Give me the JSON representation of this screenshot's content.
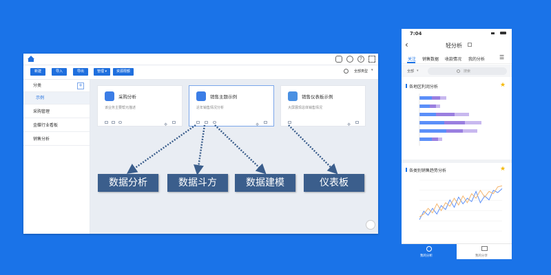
{
  "desktop": {
    "toolbar_buttons": [
      "新建",
      "导入",
      "导出",
      "管理",
      "资源限额"
    ],
    "type_filter": "全部类型",
    "sidebar": {
      "header": "分类",
      "add": "+",
      "items": [
        "示例",
        "采购管理",
        "金蝶行业看板",
        "销售分析"
      ]
    },
    "cards": [
      {
        "title": "采购分析",
        "desc": "该业务主要帮允描述"
      },
      {
        "title": "销售主题示例",
        "desc": "近年销售情况分析"
      },
      {
        "title": "销售仪表板示例",
        "desc": "大屏展现总体销售情况"
      }
    ]
  },
  "labels": [
    "数据分析",
    "数据斗方",
    "数据建模",
    "仪表板"
  ],
  "phone": {
    "time": "7:04",
    "title": "轻分析",
    "tabs": [
      "关注",
      "销售数据",
      "收款情况",
      "我的分析"
    ],
    "filter": "全部",
    "search_placeholder": "搜索",
    "card1_title": "各地区利润分析",
    "card2_title": "各类别销售趋势分析",
    "bottom_tabs": [
      "我的分析",
      "我的分享"
    ],
    "colors": {
      "accent": "#1a73e8",
      "series1": "#5b8ff9",
      "series2": "#9a7fe0",
      "series3": "#f5b56c"
    }
  },
  "chart_data": [
    {
      "type": "bar",
      "title": "各地区利润分析",
      "categories": [
        "",
        "",
        "",
        "",
        "",
        ""
      ],
      "series": [
        {
          "values": [
            6,
            5,
            8,
            12,
            13,
            6
          ]
        },
        {
          "values": [
            4,
            3,
            9,
            10,
            8,
            3
          ]
        },
        {
          "values": [
            3,
            2,
            7,
            8,
            7,
            2
          ]
        }
      ]
    },
    {
      "type": "line",
      "title": "各类别销售趋势分析",
      "x": [
        1,
        2,
        3,
        4,
        5,
        6,
        7,
        8,
        9,
        10,
        11,
        12,
        13,
        14,
        15,
        16,
        17,
        18,
        19,
        20
      ],
      "series": [
        {
          "values": [
            20,
            35,
            28,
            40,
            30,
            45,
            38,
            55,
            42,
            60,
            48,
            58,
            52,
            70,
            50,
            62,
            55,
            72,
            68,
            75
          ]
        },
        {
          "values": [
            25,
            30,
            40,
            32,
            48,
            36,
            50,
            44,
            58,
            46,
            62,
            50,
            66,
            58,
            72,
            60,
            70,
            66,
            78,
            80
          ]
        }
      ]
    }
  ]
}
